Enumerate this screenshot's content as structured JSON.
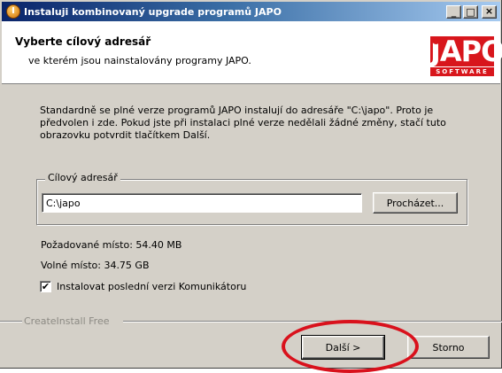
{
  "window": {
    "title": "Instaluji kombinovaný upgrade programů JAPO",
    "app_icon_glyph": "I",
    "minimize_glyph": "_",
    "maximize_glyph": "□",
    "close_glyph": "×"
  },
  "header": {
    "title": "Vyberte cílový adresář",
    "subtitle": "ve kterém jsou nainstalovány programy JAPO.",
    "logo": {
      "word": "JAPO",
      "sub": "SOFTWARE"
    }
  },
  "body": {
    "text": "Standardně se plné verze programů JAPO instalují do adresáře \"C:\\japo\". Proto je předvolen i zde. Pokud jste při instalaci plné verze nedělali žádné změny, stačí tuto obrazovku potvrdit tlačítkem Další."
  },
  "target": {
    "legend": "Cílový adresář",
    "path_value": "C:\\japo",
    "browse_label": "Procházet..."
  },
  "space": {
    "required": "Požadované místo: 54.40 MB",
    "free": "Volné místo: 34.75 GB"
  },
  "option": {
    "checked": true,
    "check_glyph": "✔",
    "label": "Instalovat poslední verzi Komunikátoru"
  },
  "footer": {
    "brand": "CreateInstall Free",
    "next_label": "Další >",
    "cancel_label": "Storno"
  },
  "colors": {
    "titlebar_start": "#0a246a",
    "titlebar_end": "#a6caf0",
    "dialog_face": "#d4d0c8",
    "logo_red": "#d8161c",
    "highlight_ring": "#d9111c"
  }
}
